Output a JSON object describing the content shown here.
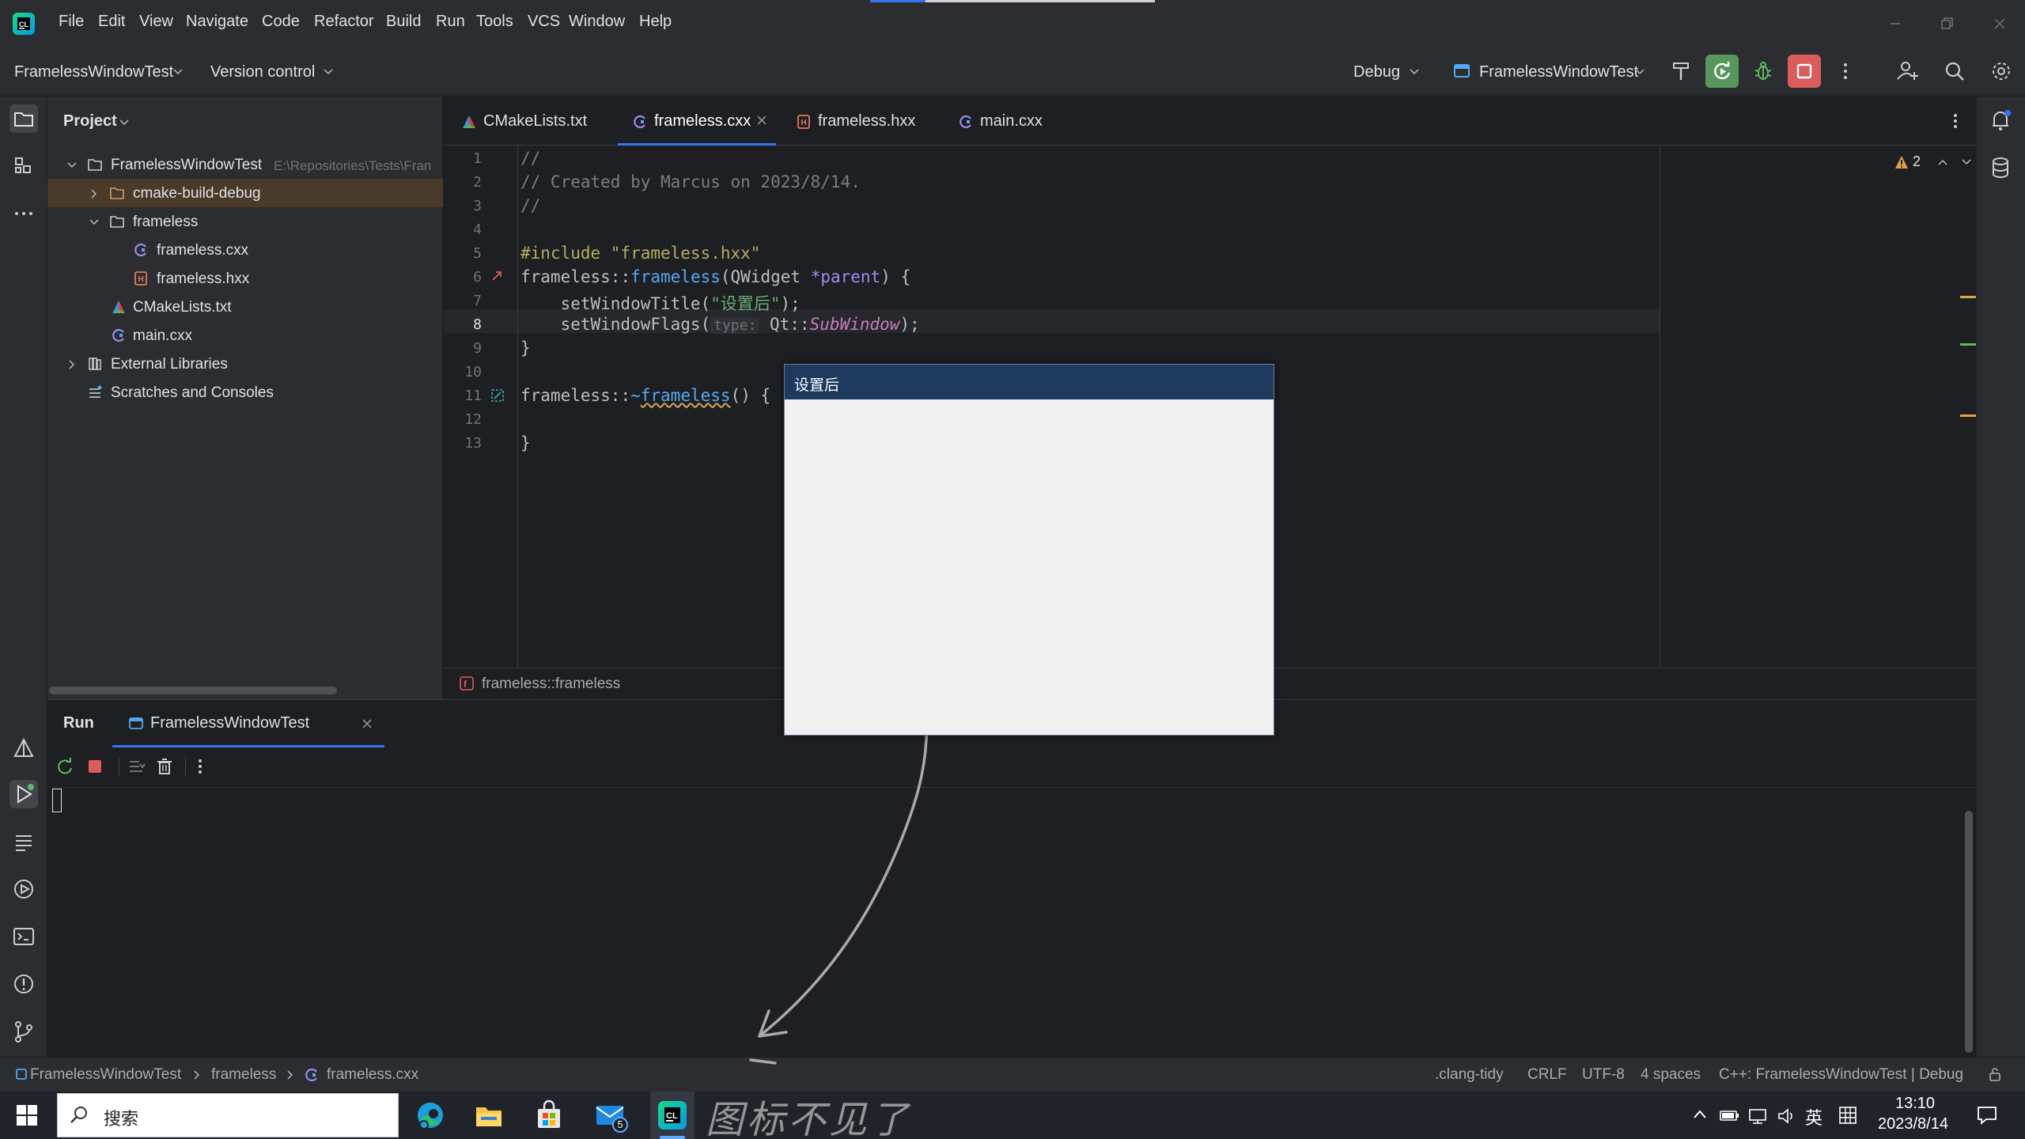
{
  "menu": [
    "File",
    "Edit",
    "View",
    "Navigate",
    "Code",
    "Refactor",
    "Build",
    "Run",
    "Tools",
    "VCS",
    "Window",
    "Help"
  ],
  "toolbar": {
    "project_name": "FramelessWindowTest",
    "vcs_label": "Version control",
    "config": "Debug",
    "run_target": "FramelessWindowTest"
  },
  "project_panel": {
    "title": "Project",
    "root": {
      "name": "FramelessWindowTest",
      "path": "E:\\Repositories\\Tests\\Fran"
    },
    "items": [
      {
        "label": "cmake-build-debug"
      },
      {
        "label": "frameless"
      },
      {
        "label": "frameless.cxx"
      },
      {
        "label": "frameless.hxx"
      },
      {
        "label": "CMakeLists.txt"
      },
      {
        "label": "main.cxx"
      },
      {
        "label": "External Libraries"
      },
      {
        "label": "Scratches and Consoles"
      }
    ]
  },
  "tabs": [
    {
      "label": "CMakeLists.txt"
    },
    {
      "label": "frameless.cxx",
      "active": true
    },
    {
      "label": "frameless.hxx"
    },
    {
      "label": "main.cxx"
    }
  ],
  "editor": {
    "warnings": "2",
    "line_numbers": [
      "1",
      "2",
      "3",
      "4",
      "5",
      "6",
      "7",
      "8",
      "9",
      "10",
      "11",
      "12",
      "13"
    ],
    "lines": {
      "l1": "//",
      "l2": "// Created by Marcus on 2023/8/14.",
      "l3": "//",
      "l5": "#include \"frameless.hxx\"",
      "l6_a": "frameless",
      "l6_b": "::",
      "l6_c": "frameless",
      "l6_d": "(QWidget ",
      "l6_e": "*parent",
      "l6_f": ") {",
      "l7_a": "    setWindowTitle(",
      "l7_b": "\"设置后\"",
      "l7_c": ");",
      "l8_a": "    setWindowFlags(",
      "l8_hint": "type:",
      "l8_b": " Qt",
      "l8_c": "::",
      "l8_d": "SubWindow",
      "l8_e": ");",
      "l9": "}",
      "l11_a": "frameless",
      "l11_b": "::",
      "l11_c": "~",
      "l11_d": "frameless",
      "l11_e": "() {",
      "l13": "}"
    },
    "breadcrumb": "frameless::frameless"
  },
  "run_panel": {
    "title": "Run",
    "tab": "FramelessWindowTest"
  },
  "qt_window": {
    "title": "设置后"
  },
  "annotation": {
    "text": "图标不见了"
  },
  "statusbar": {
    "path": [
      "FramelessWindowTest",
      "frameless",
      "frameless.cxx"
    ],
    "clang": ".clang-tidy",
    "line_sep": "CRLF",
    "encoding": "UTF-8",
    "indent": "4 spaces",
    "context": "C++: FramelessWindowTest | Debug"
  },
  "taskbar": {
    "search_placeholder": "搜索",
    "mail_badge": "5",
    "ime": "英",
    "time": "13:10",
    "date": "2023/8/14"
  },
  "colors": {
    "bg": "#1e1f22",
    "panel": "#2b2d30",
    "accent": "#3574f0",
    "keyword": "#cf8e6d",
    "string": "#6aab73",
    "comment": "#7a7e85",
    "function": "#56a8f5"
  }
}
